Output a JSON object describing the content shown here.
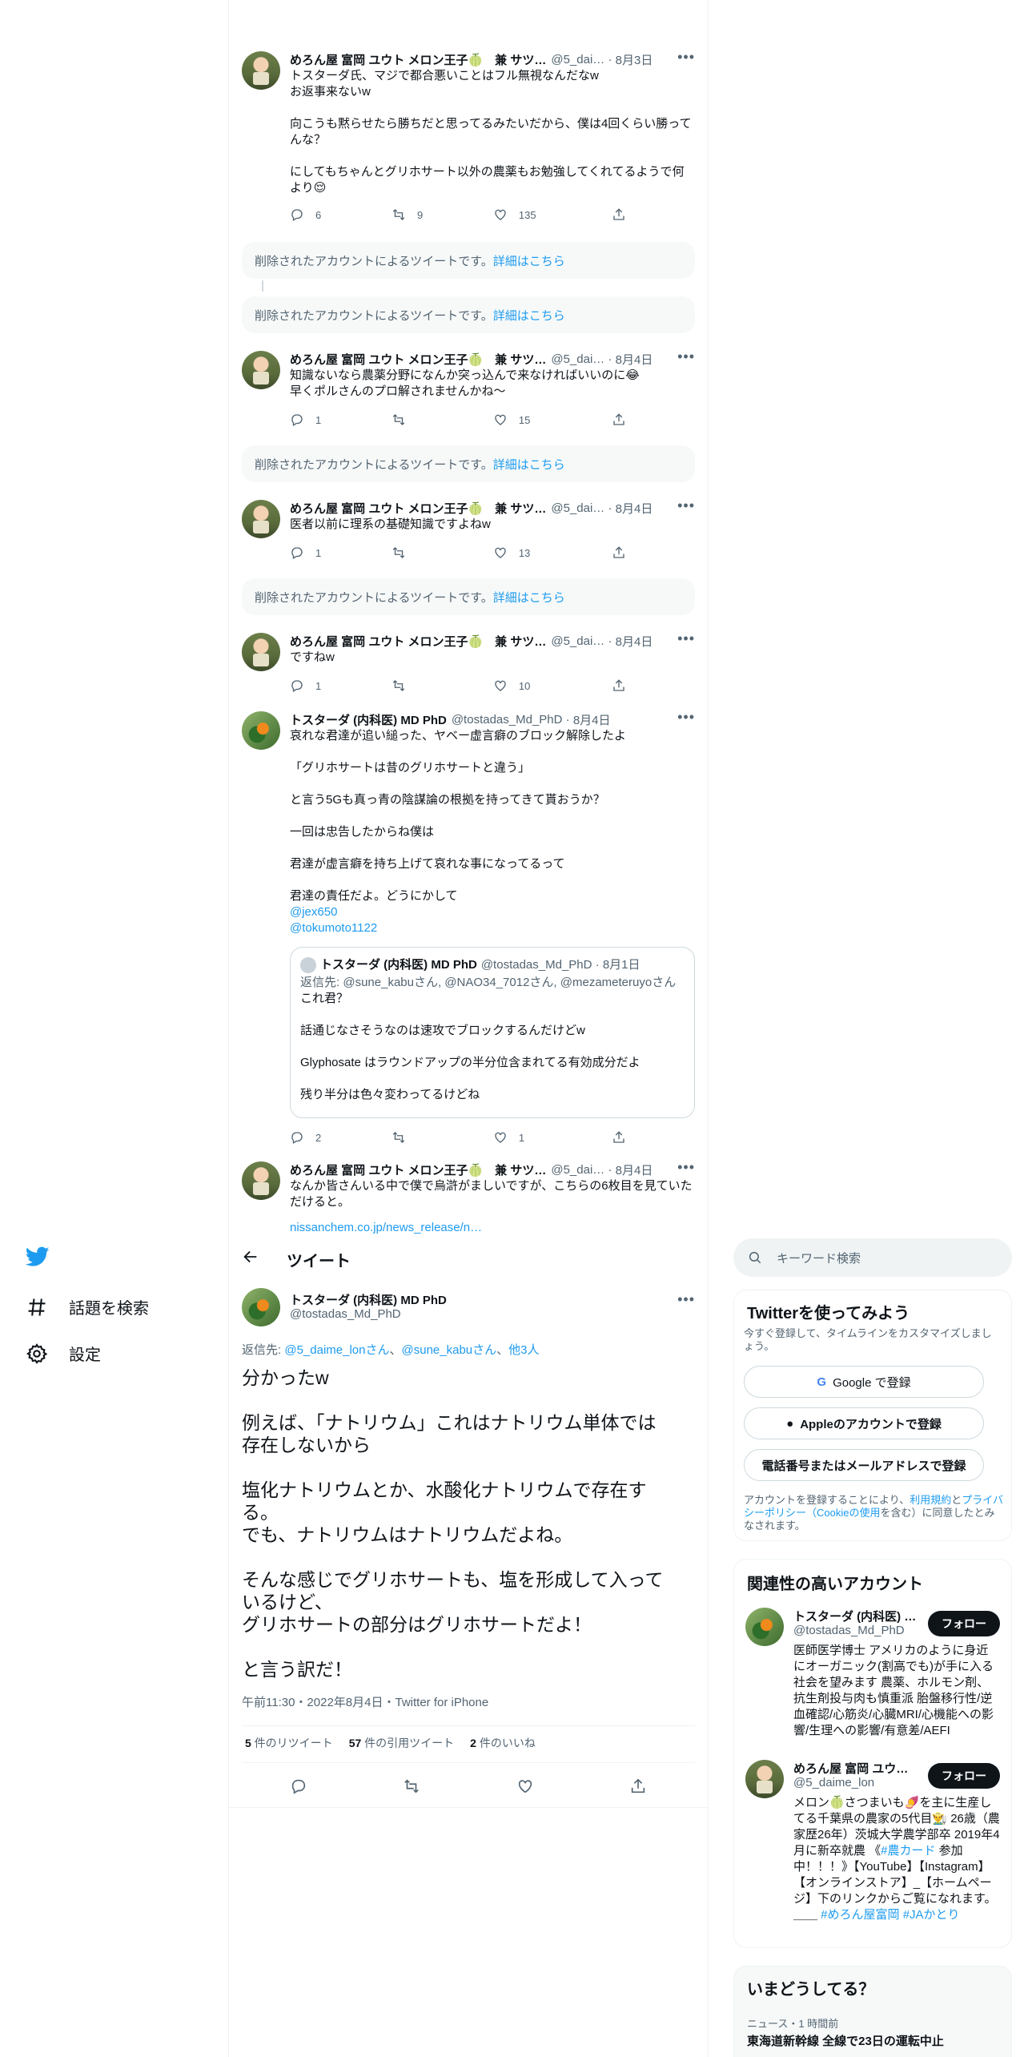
{
  "thread": {
    "t1": {
      "name": "めろん屋 富岡 ユウト メロン王子🍈　兼 サツ…",
      "handle": "@5_dai…",
      "date": "8月3日",
      "text": "トスターダ氏、マジで都合悪いことはフル無視なんだなw\nお返事来ないw\n\n向こうも黙らせたら勝ちだと思ってるみたいだから、僕は4回くらい勝ってんな？\n\nにしてもちゃんとグリホサート以外の農薬もお勉強してくれてるようで何より😌",
      "replies": "6",
      "retweets": "9",
      "likes": "135"
    },
    "deleted": {
      "text": "削除されたアカウントによるツイートです。",
      "link": "詳細はこちら"
    },
    "t2": {
      "name": "めろん屋 富岡 ユウト メロン王子🍈　兼 サツ…",
      "handle": "@5_dai…",
      "date": "8月4日",
      "text": "知識ないなら農薬分野になんか突っ込んで来なければいいのに😂\n早くポルさんのプロ解されませんかね〜",
      "replies": "1",
      "retweets": "",
      "likes": "15"
    },
    "t3": {
      "name": "めろん屋 富岡 ユウト メロン王子🍈　兼 サツ…",
      "handle": "@5_dai…",
      "date": "8月4日",
      "text": "医者以前に理系の基礎知識ですよねw",
      "replies": "1",
      "retweets": "",
      "likes": "13"
    },
    "t4": {
      "name": "めろん屋 富岡 ユウト メロン王子🍈　兼 サツ…",
      "handle": "@5_dai…",
      "date": "8月4日",
      "text": "ですねw",
      "replies": "1",
      "retweets": "",
      "likes": "10"
    },
    "t5": {
      "name": "トスターダ (内科医) MD PhD",
      "handle": "@tostadas_Md_PhD",
      "date": "8月4日",
      "text": "哀れな君達が追い縋った、ヤベー虚言癖のブロック解除したよ\n\n「グリホサートは昔のグリホサートと違う」\n\nと言う5Gも真っ青の陰謀論の根拠を持ってきて貰おうか？\n\n一回は忠告したからね僕は\n\n君達が虚言癖を持ち上げて哀れな事になってるって\n\n君達の責任だよ。どうにかして",
      "mention1": "@jex650",
      "mention2": "@tokumoto1122",
      "quote": {
        "name": "トスターダ (内科医) MD PhD",
        "handle": "@tostadas_Md_PhD",
        "date": "8月1日",
        "reply_prefix": "返信先: ",
        "reply_to": "@sune_kabuさん, @NAO34_7012さん, @mezameteruyoさん",
        "text": "これ君？\n\n話通じなさそうなのは速攻でブロックするんだけどw\n\nGlyphosate はラウンドアップの半分位含まれてる有効成分だよ\n\n残り半分は色々変わってるけどね"
      },
      "replies": "2",
      "retweets": "",
      "likes": "1"
    },
    "t6": {
      "name": "めろん屋 富岡 ユウト メロン王子🍈　兼 サツ…",
      "handle": "@5_dai…",
      "date": "8月4日",
      "text": "なんか皆さんいる中で僕で烏滸がましいですが、こちらの6枚目を見ていただけると。",
      "link": "nissanchem.co.jp/news_release/n…"
    }
  },
  "nav": {
    "explore": "話題を検索",
    "settings": "設定"
  },
  "header": {
    "title": "ツイート"
  },
  "main": {
    "name": "トスターダ (内科医) MD PhD",
    "handle": "@tostadas_Md_PhD",
    "reply_prefix": "返信先: ",
    "reply_user1": "@5_daime_lonさん",
    "reply_sep": "、",
    "reply_user2": "@sune_kabuさん",
    "reply_others": "他3人",
    "text": "分かったw\n\n例えば、「ナトリウム」これはナトリウム単体では存在しないから\n\n塩化ナトリウムとか、水酸化ナトリウムで存在する。\nでも、ナトリウムはナトリウムだよね。\n\nそんな感じでグリホサートも、塩を形成して入っているけど、\nグリホサートの部分はグリホサートだよ！\n\nと言う訳だ！",
    "meta": "午前11:30・2022年8月4日・Twitter for iPhone",
    "stats": {
      "retweets_n": "5",
      "retweets_label": " 件のリツイート",
      "quotes_n": "57",
      "quotes_label": " 件の引用ツイート",
      "likes_n": "2",
      "likes_label": " 件のいいね"
    }
  },
  "sidebar": {
    "search_placeholder": "キーワード検索",
    "signup": {
      "title": "Twitterを使ってみよう",
      "subtitle": "今すぐ登録して、タイムラインをカスタマイズしましょう。",
      "google": "Google で登録",
      "apple": "Appleのアカウントで登録",
      "phone": "電話番号またはメールアドレスで登録",
      "legal_pre": "アカウントを登録することにより、",
      "legal_terms": "利用規約",
      "legal_and": "と",
      "legal_privacy": "プライバシーポリシー（Cookieの使用",
      "legal_post": "を含む）に同意したとみなされます。"
    },
    "related": {
      "title": "関連性の高いアカウント",
      "follow_label": "フォロー",
      "accounts": [
        {
          "name": "トスターダ (内科医) …",
          "handle": "@tostadas_Md_PhD",
          "bio": "医師医学博士 アメリカのように身近にオーガニック(割高でも)が手に入る社会を望みます 農薬、ホルモン剤、抗生剤投与肉も慎重派 胎盤移行性/逆血確認/心筋炎/心臓MRI/心機能への影響/生理への影響/有意差/AEFI"
        },
        {
          "name": "めろん屋 富岡 ユウ…",
          "handle": "@5_daime_lon",
          "bio": "メロン🍈さつまいも🍠を主に生産してる千葉県の農家の5代目👨‍🌾 26歳（農家歴26年）茨城大学農学部卒 2019年4月に新卒就農 《",
          "bio_tag1": "#農カード",
          "bio_mid": " 参加中！！！》【YouTube】【Instagram】【オンラインストア】_【ホームページ】下のリンクからご覧になれます。＿＿ ",
          "bio_tag2": "#めろん屋富岡",
          "bio_sp": " ",
          "bio_tag3": "#JAかとり"
        }
      ]
    },
    "trends": {
      "title": "いまどうしてる？",
      "item1_meta": "ニュース・1 時間前",
      "item1_title": "東海道新幹線 全線で23日の運転中止"
    }
  }
}
